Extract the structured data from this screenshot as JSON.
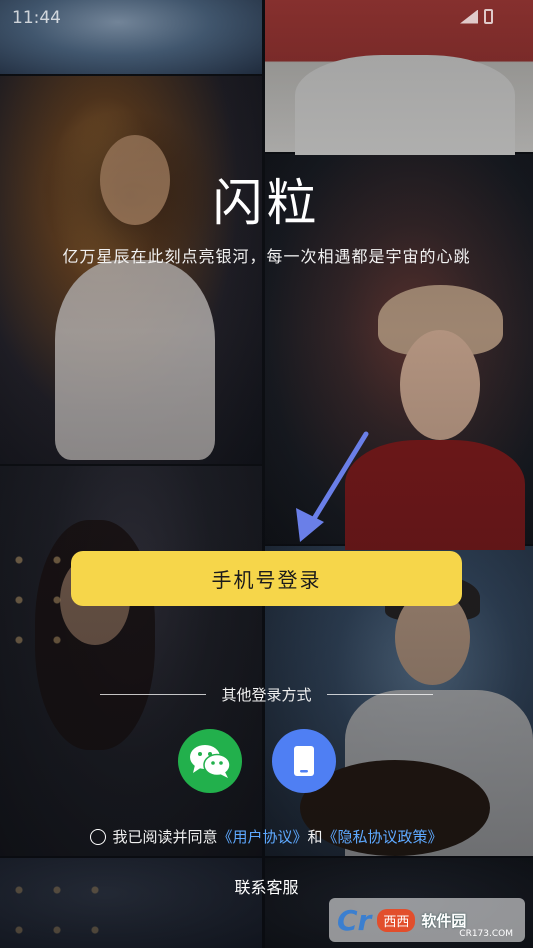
{
  "status_bar": {
    "time": "11:44"
  },
  "app": {
    "title": "闪粒",
    "tagline": "亿万星辰在此刻点亮银河，每一次相遇都是宇宙的心跳"
  },
  "login": {
    "primary_label": "手机号登录"
  },
  "alt_login": {
    "divider_label": "其他登录方式",
    "options": [
      {
        "icon": "wechat-icon"
      },
      {
        "icon": "phone-device-icon"
      }
    ]
  },
  "agreement": {
    "prefix": "我已阅读并同意",
    "user_agreement": "《用户协议》",
    "and": "和",
    "privacy_policy": "《隐私协议政策》"
  },
  "support": {
    "contact_label": "联系客服"
  },
  "watermark": {
    "logo": "Cr",
    "tag": "西西",
    "name": "软件园",
    "url": "CR173.COM"
  },
  "colors": {
    "primary_button": "#f6d64a",
    "wechat": "#22b04c",
    "device": "#4f7ff3",
    "link": "#5ea9ff",
    "arrow": "#6a7fe8"
  }
}
